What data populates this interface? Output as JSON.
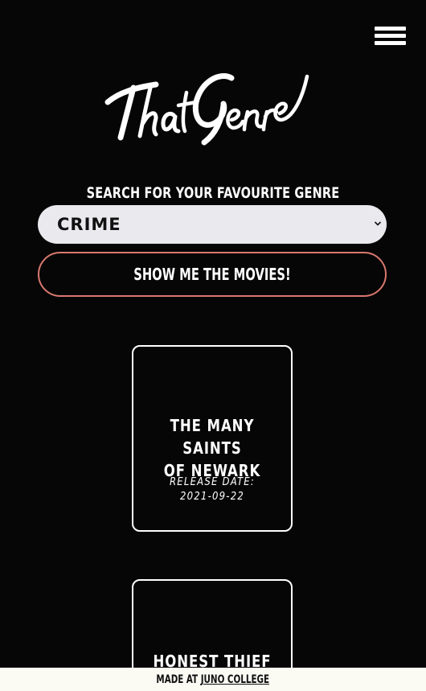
{
  "header": {
    "logo_text": "ThatGenre"
  },
  "search": {
    "label": "SEARCH FOR YOUR FAVOURITE GENRE",
    "selected_genre": "CRIME",
    "submit_label": "SHOW ME THE MOVIES!"
  },
  "movies": [
    {
      "title_line1": "THE MANY SAINTS",
      "title_line2": "OF NEWARK",
      "release_label": "RELEASE DATE:",
      "release_date": "2021-09-22"
    },
    {
      "title_line1": "HONEST THIEF",
      "title_line2": ""
    }
  ],
  "footer": {
    "prefix": "MADE AT",
    "link_text": "JUNO COLLEGE"
  },
  "colors": {
    "background": "#060606",
    "select_bg": "#e9e9ee",
    "button_border": "#d9786e",
    "footer_bg": "#fbfbf4"
  }
}
